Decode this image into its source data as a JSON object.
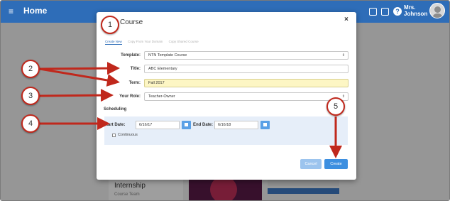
{
  "app": {
    "menu_glyph": "≡",
    "page_title": "Home",
    "user_name_line1": "Mrs.",
    "user_name_line2": "Johnson"
  },
  "background": {
    "card_title": "Internship",
    "card_subtitle": "Course Team"
  },
  "modal": {
    "title": "Course",
    "close_glyph": "×",
    "tabs": [
      {
        "label": "Create New",
        "active": true
      },
      {
        "label": "Copy From Your Domain",
        "active": false
      },
      {
        "label": "Copy Shared Course",
        "active": false
      }
    ],
    "form": {
      "template_label": "Template:",
      "template_value": "NTN Template Course",
      "title_label": "Title:",
      "title_value": "ABC Elementary",
      "term_label": "Term:",
      "term_value": "Fall 2017",
      "role_label": "Your Role:",
      "role_value": "Teacher-Owner",
      "scheduling_label": "Scheduling",
      "start_date_label": "Start Date:",
      "start_date_value": "6/16/17",
      "end_date_label": "End Date:",
      "end_date_value": "6/16/18",
      "continuous_label": "Continuous"
    },
    "buttons": {
      "cancel_label": "Cancel",
      "create_label": "Create"
    }
  },
  "callouts": [
    "1",
    "2",
    "3",
    "4",
    "5"
  ],
  "colors": {
    "topbar": "#2e6db8",
    "accent": "#3d8fe0",
    "callout_arrow": "#c0281c",
    "term_highlight": "#fdf6c4"
  }
}
